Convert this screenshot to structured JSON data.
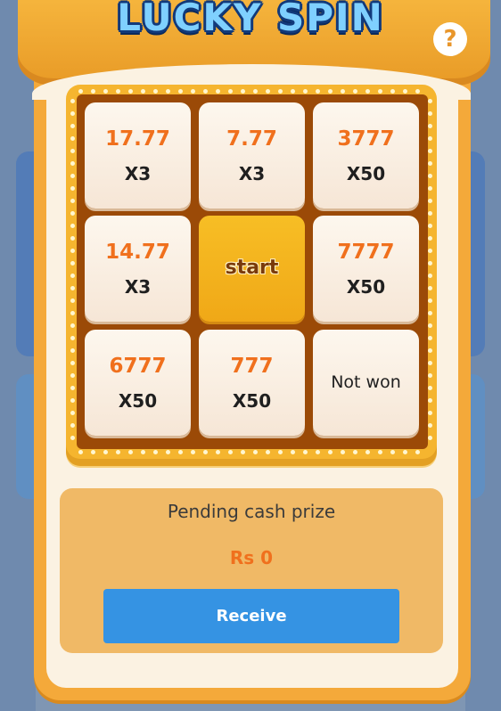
{
  "title": "LUCKY SPIN",
  "help_label": "?",
  "grid": {
    "cells": [
      {
        "amount": "17.77",
        "multiplier": "X3"
      },
      {
        "amount": "7.77",
        "multiplier": "X3"
      },
      {
        "amount": "3777",
        "multiplier": "X50"
      },
      {
        "amount": "14.77",
        "multiplier": "X3"
      },
      {
        "start_label": "start"
      },
      {
        "amount": "7777",
        "multiplier": "X50"
      },
      {
        "amount": "6777",
        "multiplier": "X50"
      },
      {
        "amount": "777",
        "multiplier": "X50"
      },
      {
        "text": "Not won"
      }
    ]
  },
  "prize": {
    "title": "Pending cash prize",
    "amount": "Rs 0",
    "button_label": "Receive"
  },
  "colors": {
    "accent_orange": "#f0701d",
    "panel": "#f4a93a",
    "button_blue": "#3593e3",
    "start_yellow": "#f0a817"
  }
}
